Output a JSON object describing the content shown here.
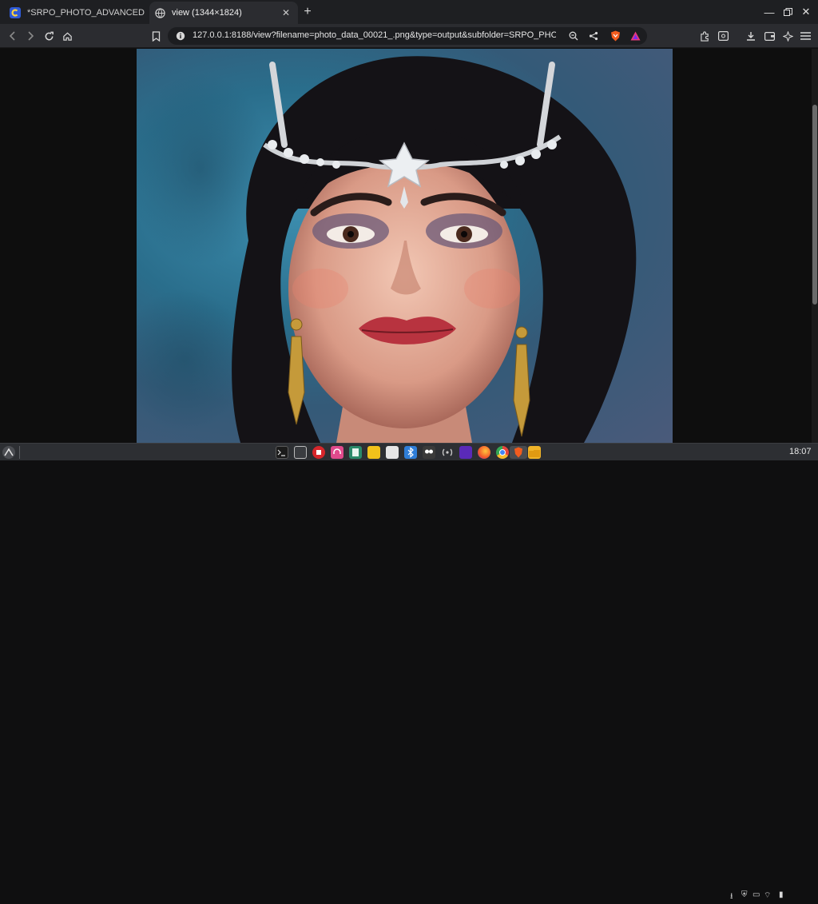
{
  "tabs": [
    {
      "title": "*SRPO_PHOTO_ADVANCED - C",
      "favicon": "comfy-logo-icon",
      "active": false
    },
    {
      "title": "view (1344×1824)",
      "favicon": "globe-icon",
      "active": true
    }
  ],
  "address_bar": {
    "url": "127.0.0.1:8188/view?filename=photo_data_00021_.png&type=output&subfolder=SRPO_PHOT..."
  },
  "page": {
    "image_alt": "Portrait of a woman with dark updo hair wearing a jeweled silver tiara, dramatic smoky eye makeup, red lips and long gold drop earrings against a blue background"
  },
  "taskbar": {
    "clock": "18:07"
  },
  "colors": {
    "tabstrip_bg": "#1e1f22",
    "toolbar_bg": "#2b2c30",
    "brave_orange": "#f25c1e",
    "taskbar_bg": "#2d2f33"
  }
}
